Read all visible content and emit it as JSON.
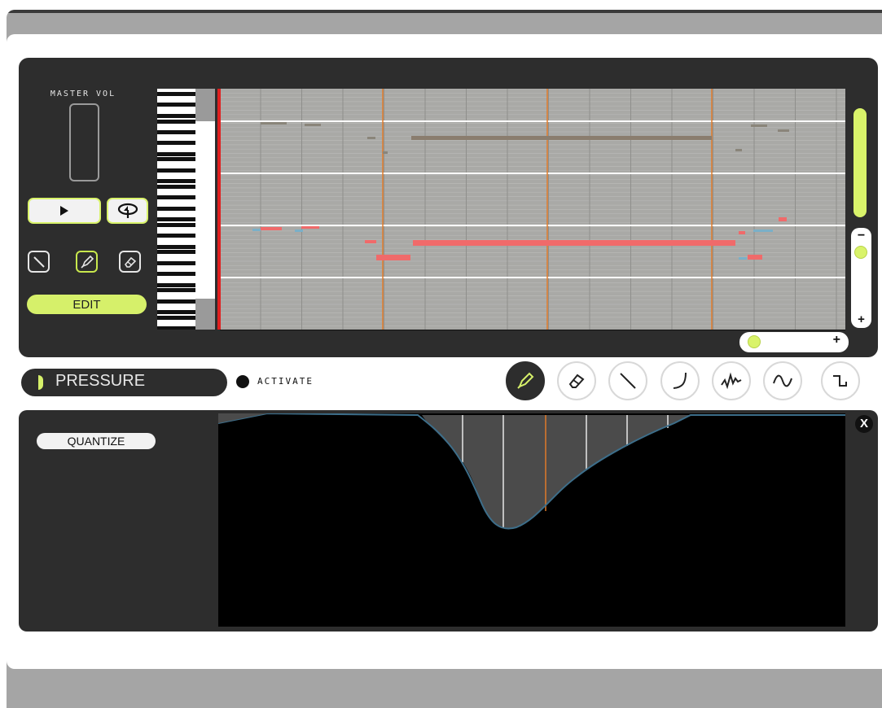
{
  "master": {
    "label": "MASTER VOL"
  },
  "transport": {
    "play_icon": "play-icon",
    "loop_icon": "loop-icon"
  },
  "tools": {
    "line_icon": "line-icon",
    "pencil_icon": "pencil-icon",
    "eraser_icon": "eraser-icon",
    "edit_label": "EDIT"
  },
  "automation": {
    "parameter": "PRESSURE",
    "activate_label": "ACTIVATE",
    "quantize_label": "QUANTIZE",
    "close_label": "X",
    "curve_tools": [
      "pencil-icon",
      "eraser-icon",
      "line-icon",
      "curve-icon",
      "random-icon",
      "sine-icon",
      "square-icon"
    ]
  },
  "zoom": {
    "minus": "−",
    "plus": "+"
  },
  "colors": {
    "accent": "#d6f06a",
    "panel": "#2d2d2d",
    "note_red": "#f06a6a",
    "note_gray": "#8a857a",
    "playhead": "#e02020",
    "marker": "#e07b2a"
  }
}
